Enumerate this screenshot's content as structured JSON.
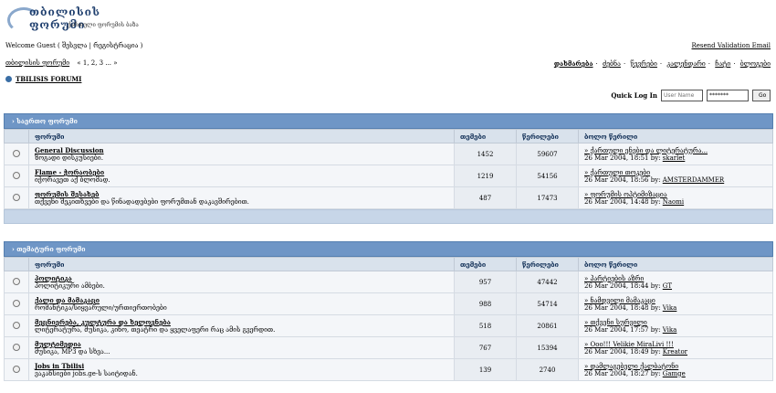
{
  "logo": {
    "main": "თბილისის ფორუმი",
    "sub": "ქართული ფორუმის ბაზა"
  },
  "top": {
    "welcome": "Welcome Guest ( შესვლა | რეგისტრაცია )",
    "resend": "Resend Validation Email"
  },
  "nav": {
    "breadcrumb": "თბილისის ფორუმი",
    "pages": "« 1, 2, 3 ... »",
    "links": [
      "დახმარება",
      "ძებნა",
      "წევრები",
      "კალენდარი",
      "ჩატი",
      "ბლოგები"
    ]
  },
  "forum_title": "TBILISIS FORUMI",
  "quicklogin": {
    "label": "Quick Log In",
    "user_placeholder": "User Name",
    "pass_value": "*******",
    "go": "Go"
  },
  "headers": {
    "forum": "ფორუმი",
    "topics": "თემები",
    "replies": "წერილები",
    "last": "ბოლო წერილი"
  },
  "categories": [
    {
      "title": "› საერთო ფორუმი",
      "forums": [
        {
          "name": "General Discussion",
          "desc": "ზოგადი დისკუსიები.",
          "topics": "1452",
          "replies": "59607",
          "last_title": "» ქართული ენები და ლიტერატურა...",
          "last_date": "26 Mar 2004, 18:51 by:",
          "last_user": "skarlet"
        },
        {
          "name": "Flame - ჭორაობები",
          "desc": "იჭორავეთ აქ ბლომად.",
          "topics": "1219",
          "replies": "54156",
          "last_title": "» ქართული თოკები",
          "last_date": "26 Mar 2004, 18:56 by:",
          "last_user": "AMSTERDAMMER"
        },
        {
          "name": "ფორუმის შესახებ",
          "desc": "თქვენი შეკითხვები და წინადადებები ფორუმთან დაკავშირებით.",
          "topics": "487",
          "replies": "17473",
          "last_title": "» ფორუმის ოპტიმიზაცია",
          "last_date": "26 Mar 2004, 14:48 by:",
          "last_user": "Naomi"
        }
      ]
    },
    {
      "title": "› თემატური ფორუმი",
      "forums": [
        {
          "name": "პოლიტიკა",
          "desc": "პოლიტიკური ამბები.",
          "topics": "957",
          "replies": "47442",
          "last_title": "» პარტიების აზრი",
          "last_date": "26 Mar 2004, 18:44 by:",
          "last_user": "GT"
        },
        {
          "name": "ქალი და მამაკაცი",
          "desc": "რომანტიკა/სიყვარული/ურთიერთობები",
          "topics": "988",
          "replies": "54714",
          "last_title": "» ნამდვილი მამაკაცი",
          "last_date": "26 Mar 2004, 18:48 by:",
          "last_user": "Vika"
        },
        {
          "name": "მეცნიერება, კულტურა და ხელოვნება",
          "desc": "ლიტერატურა, მუსიკა, კინო, თეატრი და ყველაფერი რაც ამის გვერდით.",
          "topics": "518",
          "replies": "20861",
          "last_title": "» თქვენი სურვილი",
          "last_date": "26 Mar 2004, 17:57 by:",
          "last_user": "Vika"
        },
        {
          "name": "მულტიმედია",
          "desc": "მუსიკა, MP3 და სხვა...",
          "topics": "767",
          "replies": "15394",
          "last_title": "» Ooo!!! Velikie MiraLivi !!!",
          "last_date": "26 Mar 2004, 18:49 by:",
          "last_user": "Kreator"
        },
        {
          "name": "Jobs in Tbilisi",
          "desc": "ვაკანსიები jobs.ge-ს საიტიდან.",
          "topics": "139",
          "replies": "2740",
          "last_title": "» დამლაგებელი ქალბატონი",
          "last_date": "26 Mar 2004, 18:27 by:",
          "last_user": "Gamge"
        }
      ]
    }
  ]
}
